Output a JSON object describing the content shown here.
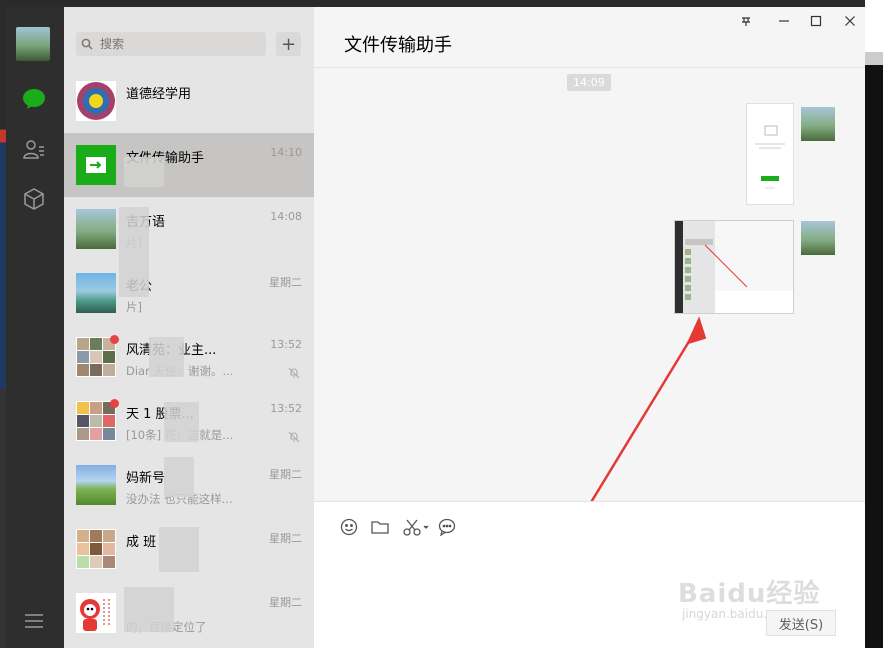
{
  "search": {
    "placeholder": "搜索"
  },
  "chats": [
    {
      "name": "道德经学用",
      "time": "",
      "preview": ""
    },
    {
      "name": "文件传输助手",
      "time": "14:10",
      "preview": ""
    },
    {
      "name": "吉万语",
      "time": "14:08",
      "preview": "片]"
    },
    {
      "name": "老公",
      "time": "星期二",
      "preview": "片]"
    },
    {
      "name": "风清苑：业主...",
      "time": "13:52",
      "preview": "Diar  天使：谢谢。..."
    },
    {
      "name": "天  1  股票...",
      "time": "13:52",
      "preview": "[10条]  花：这就是..."
    },
    {
      "name": "妈新号",
      "time": "星期二",
      "preview": "没办法  也只能这样..."
    },
    {
      "name": "成  班",
      "time": "星期二",
      "preview": ""
    },
    {
      "name": "",
      "time": "星期二",
      "preview": "的，直接定位了"
    }
  ],
  "chat": {
    "title": "文件传输助手",
    "timestamp": "14:09",
    "send_label": "发送(S)"
  },
  "watermark": {
    "main": "Baidu经验",
    "sub": "jingyan.baidu.com"
  },
  "colors": {
    "accent": "#1aad19",
    "unread": "#e64340",
    "arrow": "#e53935"
  }
}
